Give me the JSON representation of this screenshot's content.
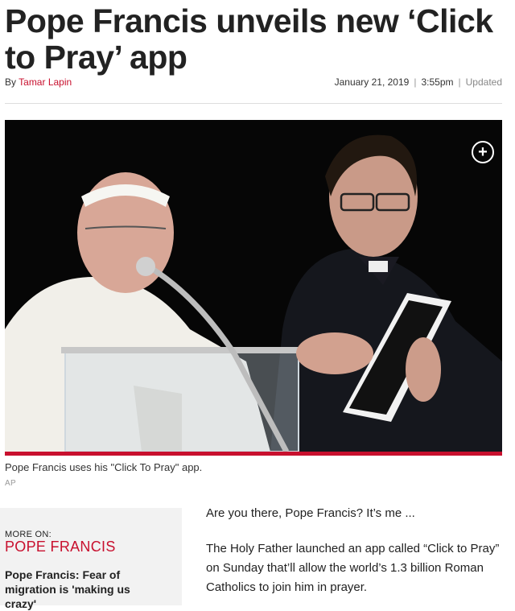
{
  "article": {
    "headline": "Pope Francis unveils new ‘Click to Pray’ app",
    "byline_prefix": "By",
    "author": "Tamar Lapin",
    "date": "January 21, 2019",
    "time": "3:55pm",
    "separator": "|",
    "updated_label": "Updated",
    "photo_caption": "Pope Francis uses his \"Click To Pray\" app.",
    "photo_credit": "AP",
    "paragraphs": [
      "Are you there, Pope Francis? It’s me ...",
      "The Holy Father launched an app called “Click to Pray” on Sunday that’ll allow the world’s 1.3 billion Roman Catholics to join him in prayer."
    ]
  },
  "photo": {
    "expand_symbol": "+"
  },
  "more_on": {
    "label": "MORE ON:",
    "topic": "POPE FRANCIS",
    "story_title": "Pope Francis: Fear of migration is 'making us crazy'"
  },
  "colors": {
    "accent": "#c8102e",
    "sidebar_bg": "#f2f2f2"
  },
  "icons": {
    "expand": "plus-circle-icon"
  }
}
